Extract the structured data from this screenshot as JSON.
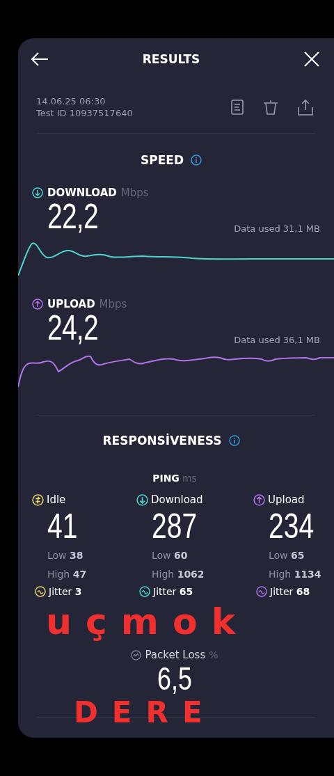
{
  "header": {
    "title": "RESULTS"
  },
  "meta": {
    "date": "14.06.25 06:30",
    "test_id": "Test ID 10937517640"
  },
  "speed": {
    "title": "SPEED",
    "metrics": [
      {
        "kind": "download",
        "label": "DOWNLOAD",
        "unit": "Mbps",
        "value": "22,2",
        "data_used": "Data used 31,1 MB"
      },
      {
        "kind": "upload",
        "label": "UPLOAD",
        "unit": "Mbps",
        "value": "24,2",
        "data_used": "Data used 36,1 MB"
      }
    ]
  },
  "responsiveness": {
    "title": "RESPONSİVENESS",
    "ping_label": "PING",
    "ping_unit": "ms",
    "columns": [
      {
        "kind": "idle",
        "label": "Idle",
        "value": "41",
        "low_label": "Low",
        "low": "38",
        "high_label": "High",
        "high": "47",
        "jitter_label": "Jitter",
        "jitter": "3"
      },
      {
        "kind": "download",
        "label": "Download",
        "value": "287",
        "low_label": "Low",
        "low": "60",
        "high_label": "High",
        "high": "1062",
        "jitter_label": "Jitter",
        "jitter": "65"
      },
      {
        "kind": "upload",
        "label": "Upload",
        "value": "234",
        "low_label": "Low",
        "low": "65",
        "high_label": "High",
        "high": "1134",
        "jitter_label": "Jitter",
        "jitter": "68"
      }
    ],
    "packet_loss": {
      "label": "Packet Loss",
      "unit": "%",
      "value": "6,5"
    }
  },
  "annotation": {
    "lines": [
      "uçmok",
      "DERE"
    ]
  }
}
